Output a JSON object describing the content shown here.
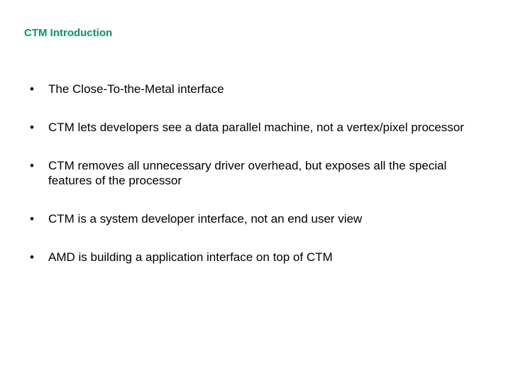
{
  "title": "CTM Introduction",
  "bullets": [
    "The Close-To-the-Metal interface",
    "CTM lets developers see a data parallel machine,  not a vertex/pixel processor",
    "CTM removes all unnecessary driver overhead, but exposes all the special features of the processor",
    "CTM is a system developer interface, not an end user view",
    "AMD is building a application interface on top of CTM"
  ]
}
